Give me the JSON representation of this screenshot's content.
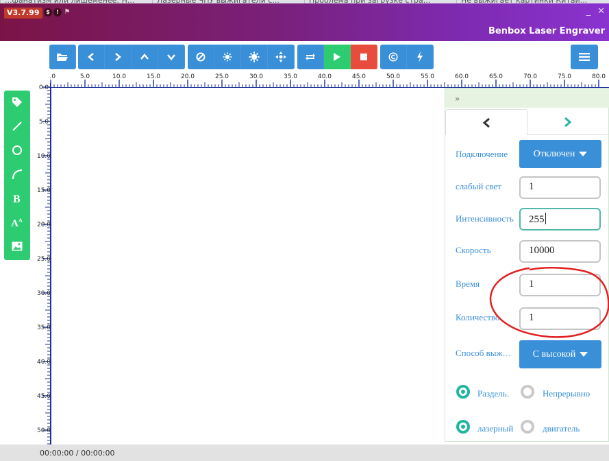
{
  "browser_tabs": [
    "...фанатизм или лишеменее: Н...",
    "Лазерные ЧПУ выжигатели с...",
    "Проблема при загрузке стра...",
    "Не выжигает картинки Китай..."
  ],
  "header": {
    "version": "V3.7.99",
    "title": "Benbox Laser Engraver",
    "window_controls": [
      "_",
      "✕"
    ],
    "version_icons": [
      "$",
      "!",
      "⚑"
    ]
  },
  "toolbar": {
    "groups": [
      [
        {
          "name": "open-folder-icon",
          "glyph": "📂"
        }
      ],
      [
        {
          "name": "move-left-icon",
          "glyph": "‹"
        },
        {
          "name": "move-right-icon",
          "glyph": "›"
        },
        {
          "name": "move-up-icon",
          "glyph": "˄"
        },
        {
          "name": "move-down-icon",
          "glyph": "˅"
        }
      ],
      [
        {
          "name": "ban-icon",
          "glyph": "⊘"
        },
        {
          "name": "sun-small-icon",
          "glyph": "✹"
        },
        {
          "name": "sun-large-icon",
          "glyph": "✺"
        },
        {
          "name": "crosshair-icon",
          "glyph": "✥"
        }
      ],
      [
        {
          "name": "repeat-icon",
          "glyph": "⟲"
        },
        {
          "name": "play-icon",
          "glyph": "▶"
        },
        {
          "name": "stop-icon",
          "glyph": "■"
        }
      ],
      [
        {
          "name": "copyright-icon",
          "glyph": "©"
        },
        {
          "name": "bolt-icon",
          "glyph": "ϟ"
        }
      ]
    ],
    "menu_icon": "hamburger-menu-icon"
  },
  "ruler": {
    "h_labels": [
      "0.0",
      "5.0",
      "10.0",
      "15.0",
      "20.0",
      "25.0",
      "30.0",
      "35.0",
      "40.0",
      "45.0",
      "50.0",
      "55.0",
      "60.0",
      "65.0",
      "70.0",
      "75.0",
      "80.0"
    ],
    "v_labels": [
      "0.0",
      "5.0",
      "10.0",
      "15.0",
      "20.0",
      "25.0",
      "30.0",
      "35.0",
      "40.0",
      "45.0",
      "50.0"
    ]
  },
  "palette": [
    "tag-icon",
    "line-icon",
    "circle-icon",
    "arc-icon",
    "bold-text-icon",
    "font-size-icon",
    "image-icon"
  ],
  "panel": {
    "collapse_label": "»",
    "fields": [
      {
        "label": "Подключение",
        "type": "dropdown",
        "value": "Отключен"
      },
      {
        "label": "слабый свет",
        "type": "input",
        "value": "1"
      },
      {
        "label": "Интенсивность",
        "type": "input",
        "value": "255",
        "focused": true
      },
      {
        "label": "Скорость",
        "type": "input",
        "value": "10000"
      },
      {
        "label": "Время",
        "type": "input",
        "value": "1"
      },
      {
        "label": "Количество",
        "type": "input",
        "value": "1"
      },
      {
        "label": "Способ выжигания",
        "type": "dropdown",
        "value": "С высокой"
      }
    ],
    "radios": [
      {
        "label": "Раздель.",
        "checked": true
      },
      {
        "label": "Непрерывно",
        "checked": false
      },
      {
        "label": "лазерный",
        "checked": true
      },
      {
        "label": "двигатель",
        "checked": false
      }
    ]
  },
  "annotation_color": "#e02020",
  "status": {
    "time": "00:00:00 / 00:00:00"
  }
}
